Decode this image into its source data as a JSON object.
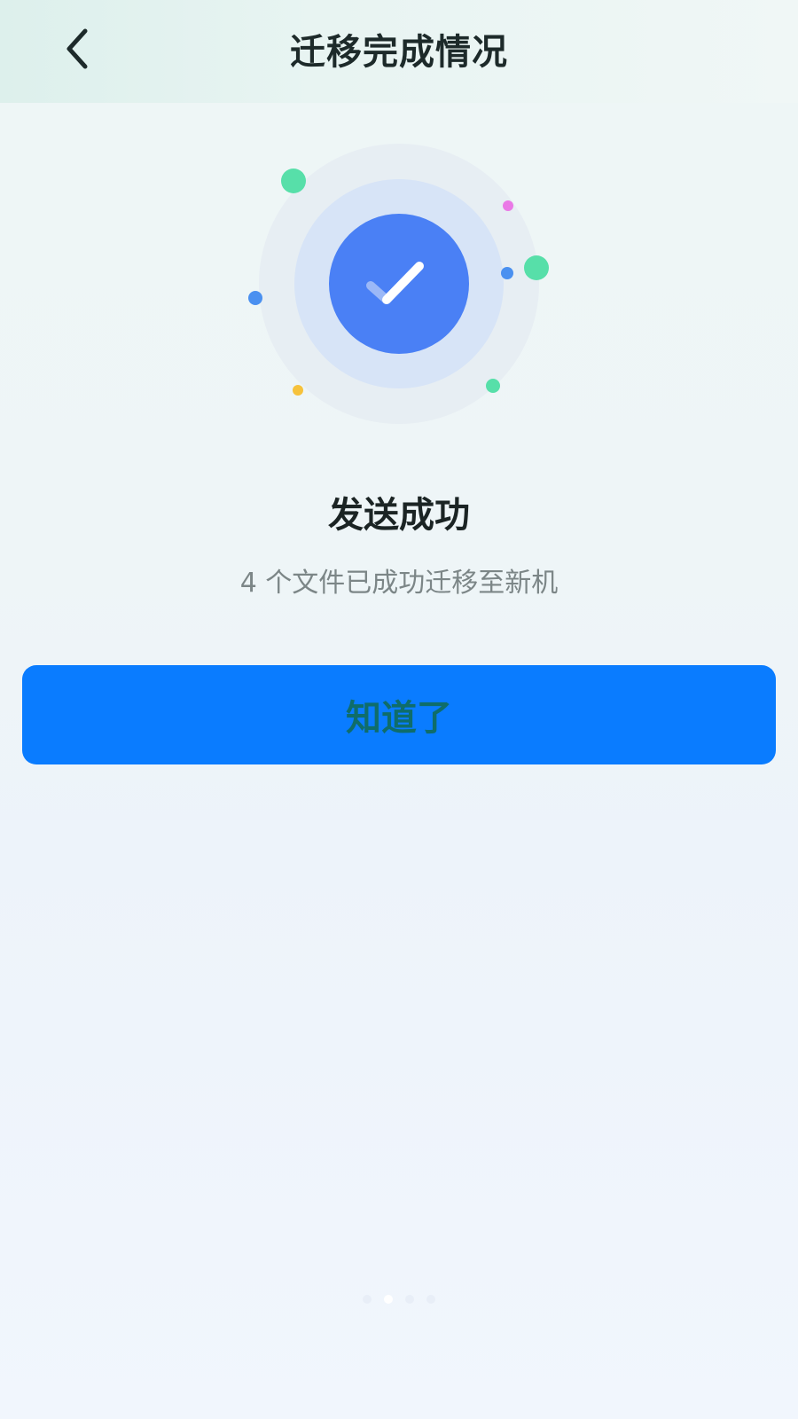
{
  "header": {
    "title": "迁移完成情况",
    "back_icon": "chevron-left-icon"
  },
  "result": {
    "icon": "check-circle-icon",
    "title": "发送成功",
    "detail": "4 个文件已成功迁移至新机"
  },
  "actions": {
    "ok_label": "知道了"
  },
  "pager": {
    "count": 4,
    "active_index": 1
  },
  "colors": {
    "primary_button": "#0a7cff",
    "check_circle": "#4a80f5",
    "button_text": "#0f6d6a"
  }
}
